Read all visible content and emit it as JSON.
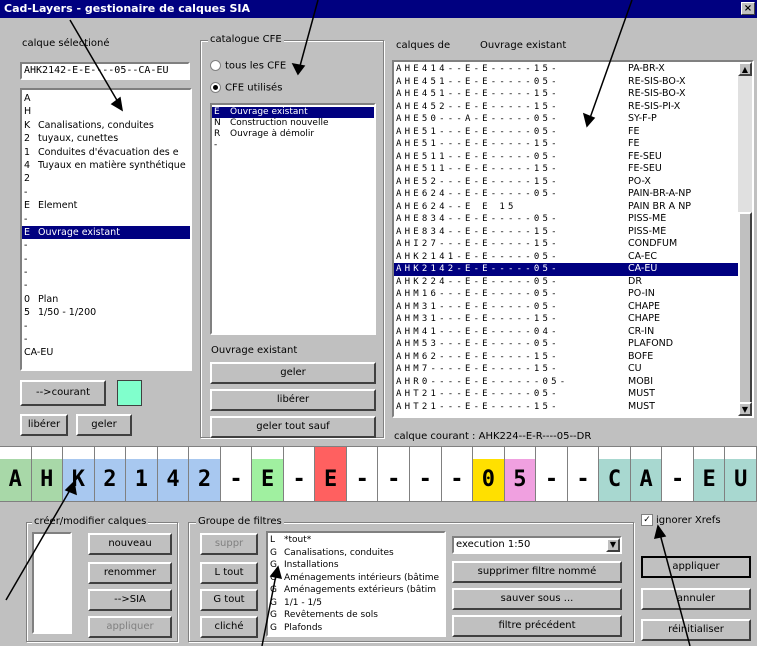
{
  "window": {
    "title": "Cad-Layers - gestionaire de calques SIA",
    "close": "×"
  },
  "left": {
    "label": "calque sélectioné",
    "current_value": "AHK2142-E-E----05--CA-EU",
    "list": [
      {
        "code": "A",
        "text": ""
      },
      {
        "code": "H",
        "text": ""
      },
      {
        "code": "K",
        "text": "Canalisations, conduites"
      },
      {
        "code": "2",
        "text": "tuyaux, cunettes"
      },
      {
        "code": "1",
        "text": "Conduites d'évacuation des e"
      },
      {
        "code": "4",
        "text": "Tuyaux en matière synthétique"
      },
      {
        "code": "2",
        "text": ""
      },
      {
        "code": "-",
        "text": ""
      },
      {
        "code": "E",
        "text": "Element"
      },
      {
        "code": "-",
        "text": ""
      },
      {
        "code": "E",
        "text": "Ouvrage existant"
      },
      {
        "code": "-",
        "text": ""
      },
      {
        "code": "-",
        "text": ""
      },
      {
        "code": "-",
        "text": ""
      },
      {
        "code": "-",
        "text": ""
      },
      {
        "code": "0",
        "text": "Plan"
      },
      {
        "code": "5",
        "text": "1/50 - 1/200"
      },
      {
        "code": "-",
        "text": ""
      },
      {
        "code": "-",
        "text": ""
      },
      {
        "code": "CA-EU",
        "text": ""
      }
    ],
    "selected_index": 10,
    "courant_button": "-->courant",
    "color_swatch": "#80ffcc",
    "liberer_button": "libérer",
    "geler_button": "geler"
  },
  "cfe": {
    "group_label": "catalogue CFE",
    "radio_all": "tous les CFE",
    "radio_used": "CFE utilisés",
    "items": [
      {
        "code": "E",
        "text": "Ouvrage existant"
      },
      {
        "code": "N",
        "text": "Construction nouvelle"
      },
      {
        "code": "R",
        "text": "Ouvrage à démolir"
      },
      {
        "code": "-",
        "text": ""
      }
    ],
    "selected_index": 0,
    "status": "Ouvrage existant",
    "geler": "geler",
    "liberer": "libérer",
    "geler_tout": "geler tout sauf"
  },
  "layers": {
    "header_left": "calques de",
    "header_right": "Ouvrage existant",
    "rows": [
      {
        "code": "AHE414--E-E-----15-",
        "name": "PA-BR-X"
      },
      {
        "code": "AHE451--E-E-----05-",
        "name": "RE-SIS-BO-X"
      },
      {
        "code": "AHE451--E-E-----15-",
        "name": "RE-SIS-BO-X"
      },
      {
        "code": "AHE452--E-E-----15-",
        "name": "RE-SIS-PI-X"
      },
      {
        "code": "AHE50---A-E-----05-",
        "name": "SY-F-P"
      },
      {
        "code": "AHE51---E-E-----05-",
        "name": "FE"
      },
      {
        "code": "AHE51---E-E-----15-",
        "name": "FE"
      },
      {
        "code": "AHE511--E-E-----05-",
        "name": "FE-SEU"
      },
      {
        "code": "AHE511--E-E-----15-",
        "name": "FE-SEU"
      },
      {
        "code": "AHE52---E-E-----15-",
        "name": "PO-X"
      },
      {
        "code": "AHE624--E-E-----05-",
        "name": "PAIN-BR-A-NP"
      },
      {
        "code": "AHE624--E E     15 ",
        "name": "PAIN BR A NP"
      },
      {
        "code": "AHE834--E-E-----05-",
        "name": "PISS-MÉ"
      },
      {
        "code": "AHE834--E-E-----15-",
        "name": "PISS-MÉ"
      },
      {
        "code": "AHI27---E-E-----15-",
        "name": "CONDFUM"
      },
      {
        "code": "AHK2141-E-E-----05-",
        "name": "CA-EC"
      },
      {
        "code": "AHK2142-E-E-----05-",
        "name": "CA-EU"
      },
      {
        "code": "AHK224--E-E-----05-",
        "name": "DR"
      },
      {
        "code": "AHM16---E-E-----05-",
        "name": "PO-IN"
      },
      {
        "code": "AHM31---E-E-----05-",
        "name": "CHAPE"
      },
      {
        "code": "AHM31---E-E-----15-",
        "name": "CHAPE"
      },
      {
        "code": "AHM41---E-E-----04-",
        "name": "CR-IN"
      },
      {
        "code": "AHM53---E-E-----05-",
        "name": "PLAFOND"
      },
      {
        "code": "AHM62---E-E-----15-",
        "name": "BOFE"
      },
      {
        "code": "AHM7----E-E-----15-",
        "name": "CU"
      },
      {
        "code": "AHR0----E-E------05-",
        "name": "MOBI"
      },
      {
        "code": "AHT21---E-E-----05-",
        "name": "MUST"
      },
      {
        "code": "AHT21---E-E-----15-",
        "name": "MUST"
      }
    ],
    "selected_index": 16,
    "current_label": "calque courant : AHK224--E-R----05--DR"
  },
  "big_code": {
    "cells": [
      {
        "ch": "A",
        "bg": "#a8d8a8"
      },
      {
        "ch": "H",
        "bg": "#a8d8a8"
      },
      {
        "ch": "K",
        "bg": "#a8c8f0"
      },
      {
        "ch": "2",
        "bg": "#a8c8f0"
      },
      {
        "ch": "1",
        "bg": "#a8c8f0"
      },
      {
        "ch": "4",
        "bg": "#a8c8f0"
      },
      {
        "ch": "2",
        "bg": "#a8c8f0"
      },
      {
        "ch": "-",
        "bg": "#ffffff"
      },
      {
        "ch": "E",
        "bg": "#a0f0a0"
      },
      {
        "ch": "-",
        "bg": "#ffffff"
      },
      {
        "ch": "E",
        "bg": "#ff6060"
      },
      {
        "ch": "-",
        "bg": "#ffffff"
      },
      {
        "ch": "-",
        "bg": "#ffffff"
      },
      {
        "ch": "-",
        "bg": "#ffffff"
      },
      {
        "ch": "-",
        "bg": "#ffffff"
      },
      {
        "ch": "0",
        "bg": "#ffe000"
      },
      {
        "ch": "5",
        "bg": "#f0a0e0"
      },
      {
        "ch": "-",
        "bg": "#ffffff"
      },
      {
        "ch": "-",
        "bg": "#ffffff"
      },
      {
        "ch": "C",
        "bg": "#a8d8d0"
      },
      {
        "ch": "A",
        "bg": "#a8d8d0"
      },
      {
        "ch": "-",
        "bg": "#ffffff"
      },
      {
        "ch": "E",
        "bg": "#a8d8d0"
      },
      {
        "ch": "U",
        "bg": "#a8d8d0"
      }
    ]
  },
  "create": {
    "group_label": "créer/modifier calques",
    "nouveau": "nouveau",
    "renommer": "renommer",
    "sia": "-->SIA",
    "appliquer": "appliquer"
  },
  "filters": {
    "group_label": "Groupe de filtres",
    "suppr": "suppr",
    "l_tout": "L tout",
    "g_tout": "G tout",
    "cliche": "cliché",
    "items": [
      {
        "code": "L",
        "text": "*tout*"
      },
      {
        "code": "G",
        "text": "Canalisations, conduites"
      },
      {
        "code": "G",
        "text": "Installations"
      },
      {
        "code": "G",
        "text": "Aménagements intérieurs (bâtime"
      },
      {
        "code": "G",
        "text": "Aménagements extérieurs (bâtim"
      },
      {
        "code": "G",
        "text": "1/1 - 1/5"
      },
      {
        "code": "G",
        "text": "Revêtements de sols"
      },
      {
        "code": "G",
        "text": "Plafonds"
      }
    ],
    "dropdown_value": "execution 1:50",
    "supprimer": "supprimer filtre nommé",
    "sauver": "sauver sous ...",
    "precedent": "filtre précédent"
  },
  "right": {
    "ignore_xrefs": "ignorer Xrefs",
    "appliquer": "appliquer",
    "annuler": "annuler",
    "reinit": "réinitialiser"
  }
}
